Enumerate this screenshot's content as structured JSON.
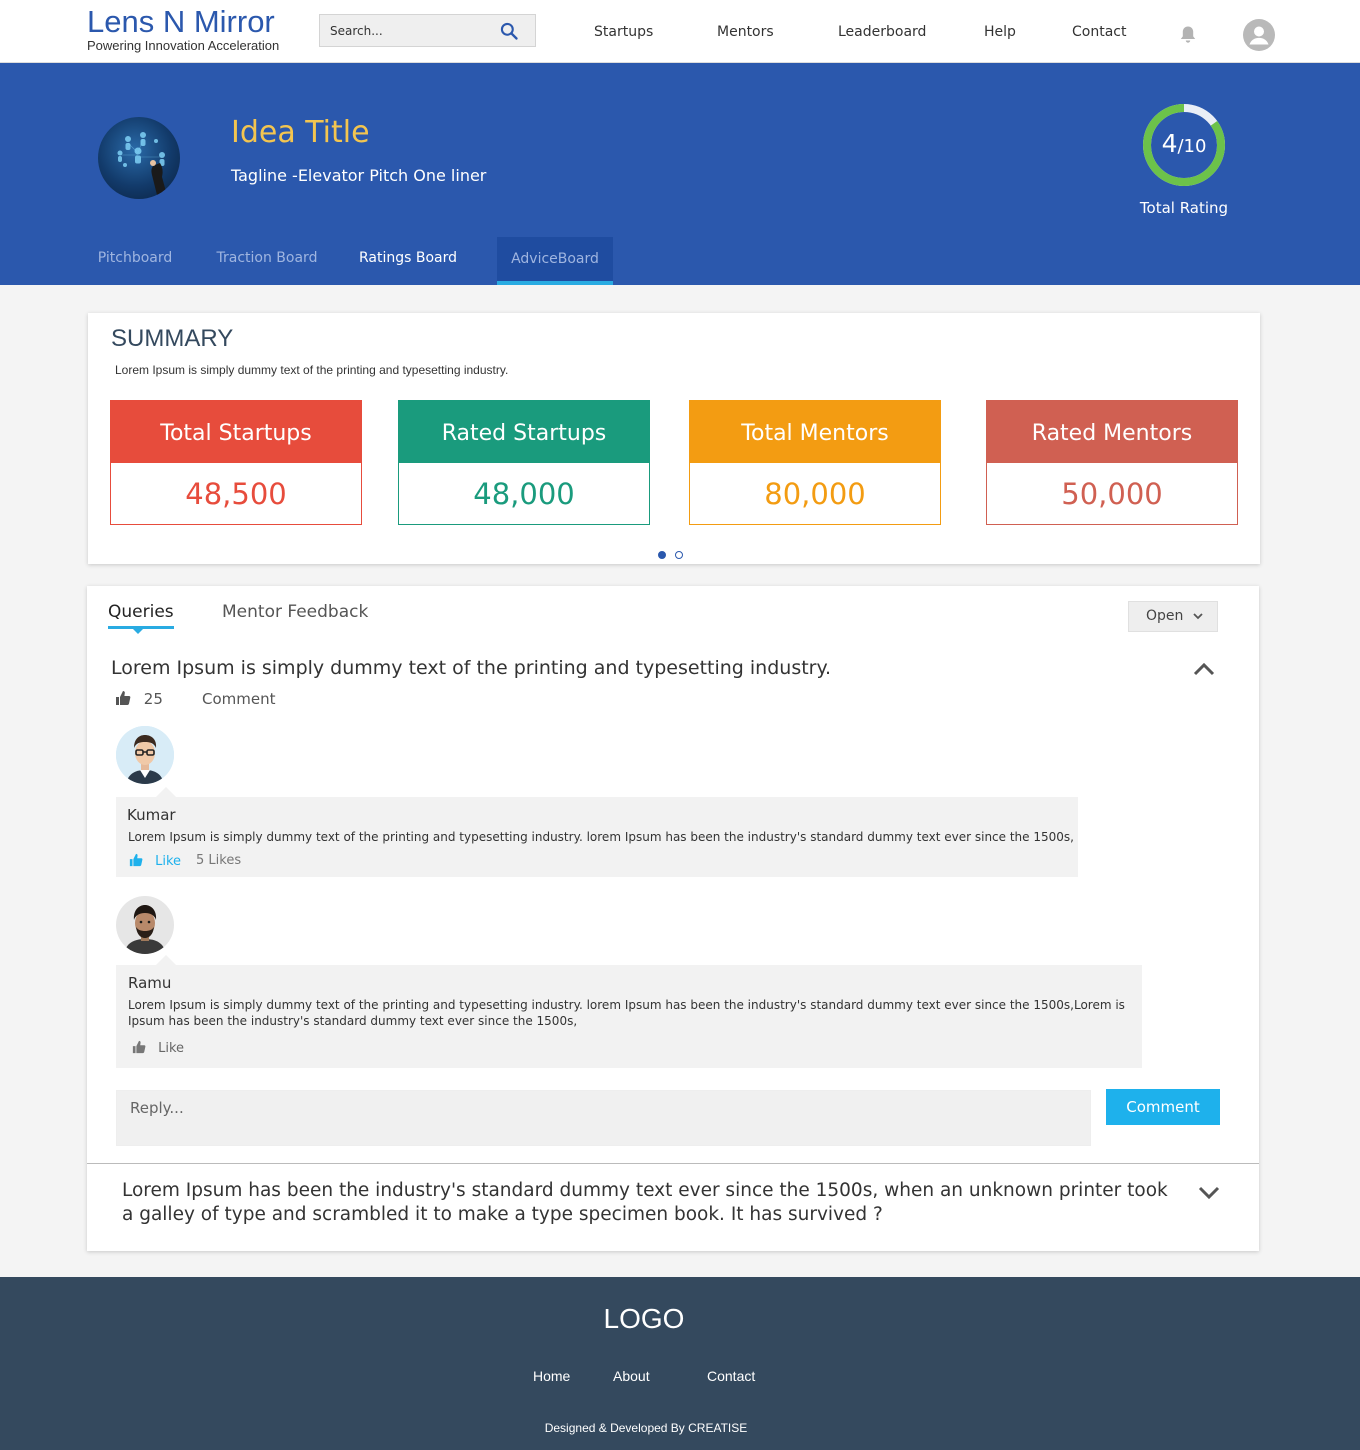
{
  "header": {
    "brand_name": "Lens N Mirror",
    "brand_tagline": "Powering Innovation Acceleration",
    "search_placeholder": "Search...",
    "nav": [
      "Startups",
      "Mentors",
      "Leaderboard",
      "Help",
      "Contact"
    ]
  },
  "hero": {
    "idea_title": "Idea Title",
    "tagline": "Tagline  -Elevator Pitch One liner",
    "rating_value": "4",
    "rating_max": "/10",
    "rating_fraction": 0.4,
    "rating_label": "Total Rating",
    "tabs": [
      "Pitchboard",
      "Traction Board",
      "Ratings Board",
      "AdviceBoard"
    ],
    "active_tab": "AdviceBoard"
  },
  "summary": {
    "title": "SUMMARY",
    "description": "Lorem Ipsum is simply dummy text of the printing and typesetting industry.",
    "stats": [
      {
        "label": "Total Startups",
        "value": "48,500",
        "color": "#e74c3c"
      },
      {
        "label": "Rated Startups",
        "value": "48,000",
        "color": "#1a9b7d"
      },
      {
        "label": "Total Mentors",
        "value": "80,000",
        "color": "#f39c12"
      },
      {
        "label": "Rated Mentors",
        "value": "50,000",
        "color": "#d06052"
      }
    ],
    "carousel_pages": 2,
    "carousel_current": 1
  },
  "queries": {
    "tabs": [
      "Queries",
      "Mentor Feedback"
    ],
    "active_tab": "Queries",
    "status_filter": "Open",
    "question1": {
      "title": "Lorem Ipsum is simply dummy text of the printing and typesetting industry.",
      "likes": "25",
      "comment_label": "Comment"
    },
    "comments": [
      {
        "name": "Kumar",
        "text": "Lorem Ipsum is simply dummy text of the printing and typesetting industry. lorem Ipsum has been the industry's standard dummy text ever since the 1500s,",
        "like_label": "Like",
        "likes_count": "5 Likes"
      },
      {
        "name": "Ramu",
        "text": "Lorem Ipsum is simply dummy text of the printing and typesetting industry. lorem Ipsum has been the industry's standard dummy text ever since the 1500s,Lorem is Ipsum has been the industry's standard dummy text ever since the 1500s,",
        "like_label": "Like"
      }
    ],
    "reply_placeholder": "Reply...",
    "comment_button": "Comment",
    "question2": {
      "title": "Lorem Ipsum has been the industry's standard dummy text ever since the 1500s, when an unknown printer took a galley of type and scrambled it to make a type specimen book. It has survived ?"
    }
  },
  "footer": {
    "logo": "LOGO",
    "links": [
      "Home",
      "About",
      "Contact"
    ],
    "credit": "Designed & Developed By CREATISE"
  },
  "colors": {
    "primary": "#2b58ad",
    "accent": "#29abe2",
    "title_gold": "#f3c550",
    "rating_green": "#6cc24a",
    "footer_bg": "#34495e"
  },
  "icons": [
    "search-icon",
    "bell-icon",
    "user-avatar-icon",
    "chevron-down-icon",
    "chevron-up-icon",
    "thumbs-up-icon"
  ]
}
